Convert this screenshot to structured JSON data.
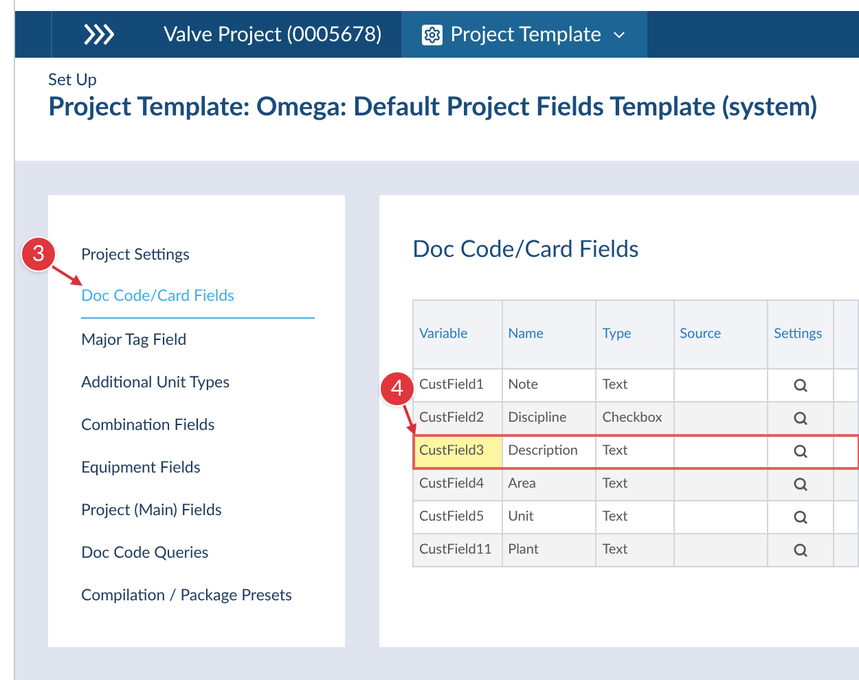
{
  "breadcrumbs": [
    {
      "label": "Valve Project (0005678)",
      "kind": "link"
    },
    {
      "label": "Project Template",
      "kind": "menu"
    }
  ],
  "header": {
    "eyebrow": "Set Up",
    "title": "Project Template: Omega: Default Project Fields Template (system)"
  },
  "sidebar": {
    "items": [
      {
        "label": "Project Settings",
        "selected": false
      },
      {
        "label": "Doc Code/Card Fields",
        "selected": true
      },
      {
        "label": "Major Tag Field",
        "selected": false
      },
      {
        "label": "Additional Unit Types",
        "selected": false
      },
      {
        "label": "Combination Fields",
        "selected": false
      },
      {
        "label": "Equipment Fields",
        "selected": false
      },
      {
        "label": "Project (Main) Fields",
        "selected": false
      },
      {
        "label": "Doc Code Queries",
        "selected": false
      },
      {
        "label": "Compilation / Package Presets",
        "selected": false
      }
    ]
  },
  "main": {
    "title": "Doc Code/Card Fields",
    "table": {
      "columns": [
        "Variable",
        "Name",
        "Type",
        "Source",
        "Settings"
      ],
      "rows": [
        {
          "variable": "CustField1",
          "name": "Note",
          "type": "Text",
          "source": "",
          "selected": false
        },
        {
          "variable": "CustField2",
          "name": "Discipline",
          "type": "Checkbox",
          "source": "",
          "selected": false
        },
        {
          "variable": "CustField3",
          "name": "Description",
          "type": "Text",
          "source": "",
          "selected": true
        },
        {
          "variable": "CustField4",
          "name": "Area",
          "type": "Text",
          "source": "",
          "selected": false
        },
        {
          "variable": "CustField5",
          "name": "Unit",
          "type": "Text",
          "source": "",
          "selected": false
        },
        {
          "variable": "CustField11",
          "name": "Plant",
          "type": "Text",
          "source": "",
          "selected": false
        }
      ]
    }
  },
  "callouts": [
    {
      "number": "3"
    },
    {
      "number": "4"
    }
  ]
}
